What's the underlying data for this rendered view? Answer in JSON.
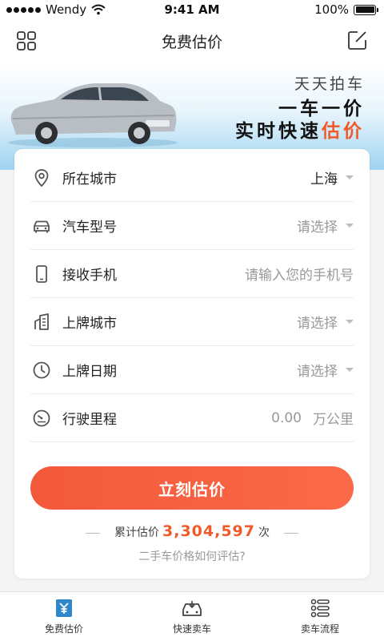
{
  "status_bar": {
    "carrier": "Wendy",
    "time": "9:41 AM",
    "battery": "100%",
    "battery_level": 1.0
  },
  "nav": {
    "title": "免费估价",
    "left_icon": "grid-icon",
    "right_icon": "edit-icon"
  },
  "banner": {
    "line1": "天天拍车",
    "line2": "一车一价",
    "line3_prefix": "实时快速",
    "line3_accent": "估价",
    "accent_color": "#f05a2a"
  },
  "form": {
    "rows": [
      {
        "label": "所在城市",
        "value": "上海",
        "icon": "location-pin-icon"
      },
      {
        "label": "汽车型号",
        "value": "请选择",
        "icon": "car-icon"
      },
      {
        "label": "接收手机",
        "placeholder": "请输入您的手机号",
        "icon": "phone-icon"
      },
      {
        "label": "上牌城市",
        "value": "请选择",
        "icon": "building-icon"
      },
      {
        "label": "上牌日期",
        "value": "请选择",
        "icon": "clock-icon"
      },
      {
        "label": "行驶里程",
        "value": "0.00",
        "unit": "万公里",
        "icon": "speedometer-icon"
      }
    ],
    "submit_label": "立刻估价",
    "stats_prefix": "累计估价",
    "stats_count": "3,304,597",
    "stats_suffix": "次",
    "howto_link": "二手车价格如何评估?"
  },
  "tabs": [
    {
      "label": "免费估价",
      "icon": "yen-document-icon",
      "active": true
    },
    {
      "label": "快速卖车",
      "icon": "car-front-icon",
      "active": false
    },
    {
      "label": "卖车流程",
      "icon": "list-icon",
      "active": false
    }
  ],
  "colors": {
    "primary": "#f2593a",
    "tab_active": "#2f86c8"
  }
}
